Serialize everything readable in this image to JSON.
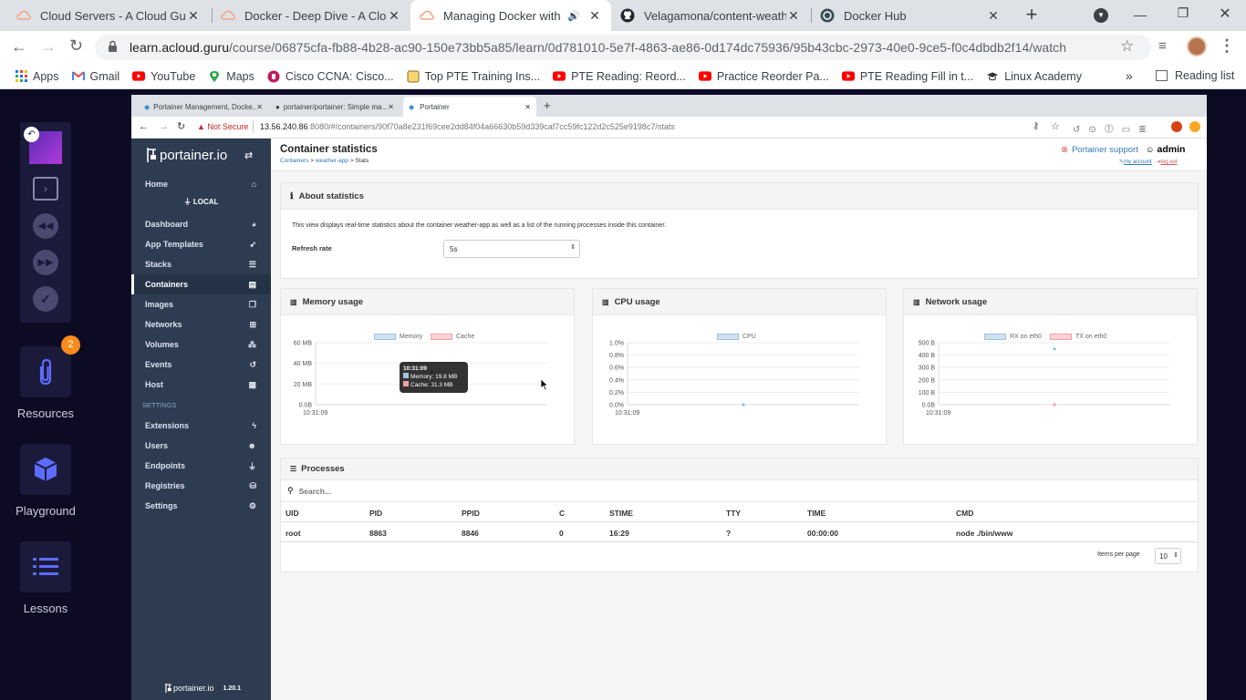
{
  "browser": {
    "tabs": [
      {
        "title": "Cloud Servers - A Cloud Guru",
        "icon": "acloudguru-cloud-icon"
      },
      {
        "title": "Docker - Deep Dive - A Cloud Guru",
        "icon": "acloudguru-cloud-icon"
      },
      {
        "title": "Managing Docker with Portainer",
        "icon": "acloudguru-cloud-icon"
      },
      {
        "title": "Velagamona/content-weather-app",
        "icon": "github-icon"
      },
      {
        "title": "Docker Hub",
        "icon": "docker-icon"
      }
    ],
    "url_host": "learn.acloud.guru",
    "url_path": "/course/06875cfa-fb88-4b28-ac90-150e73bb5a85/learn/0d781010-5e7f-4863-ae86-0d174dc75936/95b43cbc-2973-40e0-9ce5-f0c4dbdb2f14/watch",
    "bookmarks": [
      "Apps",
      "Gmail",
      "YouTube",
      "Maps",
      "Cisco CCNA: Cisco...",
      "Top PTE Training Ins...",
      "PTE Reading: Reord...",
      "Practice Reorder Pa...",
      "PTE Reading Fill in t...",
      "Linux Academy"
    ],
    "reading_list": "Reading list",
    "more": "»"
  },
  "acg_sidebar": {
    "resources_label": "Resources",
    "resources_badge": "2",
    "playground_label": "Playground",
    "lessons_label": "Lessons"
  },
  "inner_browser": {
    "tabs": [
      "Portainer Management, Docke...",
      "portainer/portainer: Simple ma...",
      "Portainer"
    ],
    "not_secure": "Not Secure",
    "url_host": "13.56.240.86",
    "url_rest": ":8080/#/containers/90f70a8e231f69cee2dd84f04a66630b59d339caf7cc59fc122d2c525e9198c7/stats"
  },
  "portainer": {
    "logo": "portainer.io",
    "footer_logo": "portainer.io",
    "version": "1.20.1",
    "nav": {
      "home": "Home",
      "endpoint": "LOCAL",
      "items": [
        "Dashboard",
        "App Templates",
        "Stacks",
        "Containers",
        "Images",
        "Networks",
        "Volumes",
        "Events",
        "Host"
      ],
      "settings_header": "SETTINGS",
      "settings_items": [
        "Extensions",
        "Users",
        "Endpoints",
        "Registries",
        "Settings"
      ]
    },
    "page_title": "Container statistics",
    "breadcrumb": {
      "a": "Containers",
      "b": "weather-app",
      "c": "Stats",
      "sep": ">"
    },
    "support": "Portainer support",
    "user": "admin",
    "my_account": "my account",
    "log_out": "log out",
    "about": {
      "title": "About statistics",
      "text": "This view displays real-time statistics about the container weather-app as well as a list of the running processes inside this container.",
      "refresh_label": "Refresh rate",
      "refresh_value": "5s"
    },
    "memory": {
      "title": "Memory usage",
      "legend": [
        "Memory",
        "Cache"
      ],
      "tooltip_time": "10:31:09",
      "tooltip_mem": "Memory: 19.8 MB",
      "tooltip_cache": "Cache: 31.3 MB"
    },
    "cpu": {
      "title": "CPU usage",
      "legend": [
        "CPU"
      ]
    },
    "network": {
      "title": "Network usage",
      "legend": [
        "RX on eth0",
        "TX on eth0"
      ]
    },
    "processes": {
      "title": "Processes",
      "search_placeholder": "Search...",
      "columns": [
        "UID",
        "PID",
        "PPID",
        "C",
        "STIME",
        "TTY",
        "TIME",
        "CMD"
      ],
      "rows": [
        [
          "root",
          "8863",
          "8846",
          "0",
          "16:29",
          "?",
          "00:00:00",
          "node ./bin/www"
        ]
      ],
      "items_per_page_label": "Items per page",
      "items_per_page": "10"
    }
  },
  "chart_data": [
    {
      "type": "line",
      "title": "Memory usage",
      "x": [
        "10:31:09"
      ],
      "series": [
        {
          "name": "Memory",
          "values": [
            19.8
          ]
        },
        {
          "name": "Cache",
          "values": [
            31.3
          ]
        }
      ],
      "yticks": [
        "60 MB",
        "40 MB",
        "20 MB",
        "0.0B"
      ],
      "ylim": [
        0,
        60
      ],
      "xticks": [
        "10:31:09"
      ],
      "colors": [
        "#b8d7ee",
        "#ffcdd2"
      ]
    },
    {
      "type": "line",
      "title": "CPU usage",
      "x": [
        "10:31:09"
      ],
      "series": [
        {
          "name": "CPU",
          "values": [
            0
          ]
        }
      ],
      "yticks": [
        "1.0%",
        "0.8%",
        "0.6%",
        "0.4%",
        "0.2%",
        "0.0%"
      ],
      "ylim": [
        0,
        1
      ],
      "xticks": [
        "10:31:09"
      ]
    },
    {
      "type": "line",
      "title": "Network usage",
      "x": [
        "10:31:09"
      ],
      "series": [
        {
          "name": "RX on eth0",
          "values": [
            450
          ]
        },
        {
          "name": "TX on eth0",
          "values": [
            0
          ]
        }
      ],
      "yticks": [
        "500 B",
        "400 B",
        "300 B",
        "200 B",
        "100 B",
        "0.0B"
      ],
      "ylim": [
        0,
        500
      ],
      "xticks": [
        "10:31:09"
      ]
    }
  ]
}
